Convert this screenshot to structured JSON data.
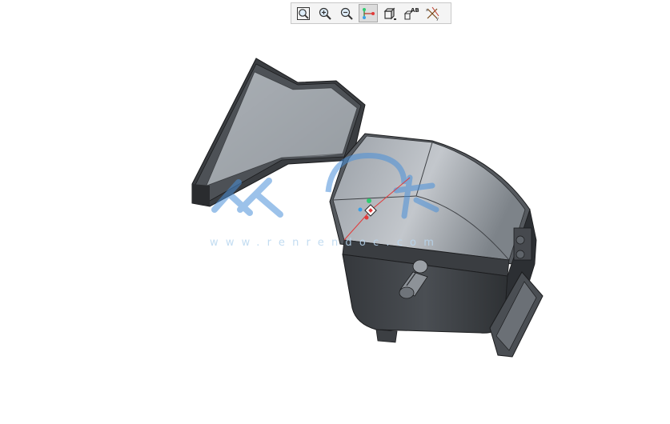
{
  "toolbar": {
    "buttons": [
      {
        "name": "refit-button",
        "icon": "refit-icon"
      },
      {
        "name": "zoom-in-button",
        "icon": "zoom-in-icon"
      },
      {
        "name": "zoom-out-button",
        "icon": "zoom-out-icon"
      },
      {
        "name": "datum-display-button",
        "icon": "datum-icon",
        "active": true
      },
      {
        "name": "view-orientation-button",
        "icon": "cube-icon"
      },
      {
        "name": "annotation-display-button",
        "icon": "annotation-icon",
        "label": "AB"
      },
      {
        "name": "axis-display-button",
        "icon": "axis-icon"
      }
    ]
  },
  "watermark": {
    "text": "www.renrendoc.com",
    "logo_color": "#4a90d9"
  },
  "colors": {
    "model_dark": "#3d4044",
    "model_mid": "#5b6066",
    "model_light": "#a7acb2",
    "background": "#ffffff",
    "edge": "#1b1c1e"
  }
}
